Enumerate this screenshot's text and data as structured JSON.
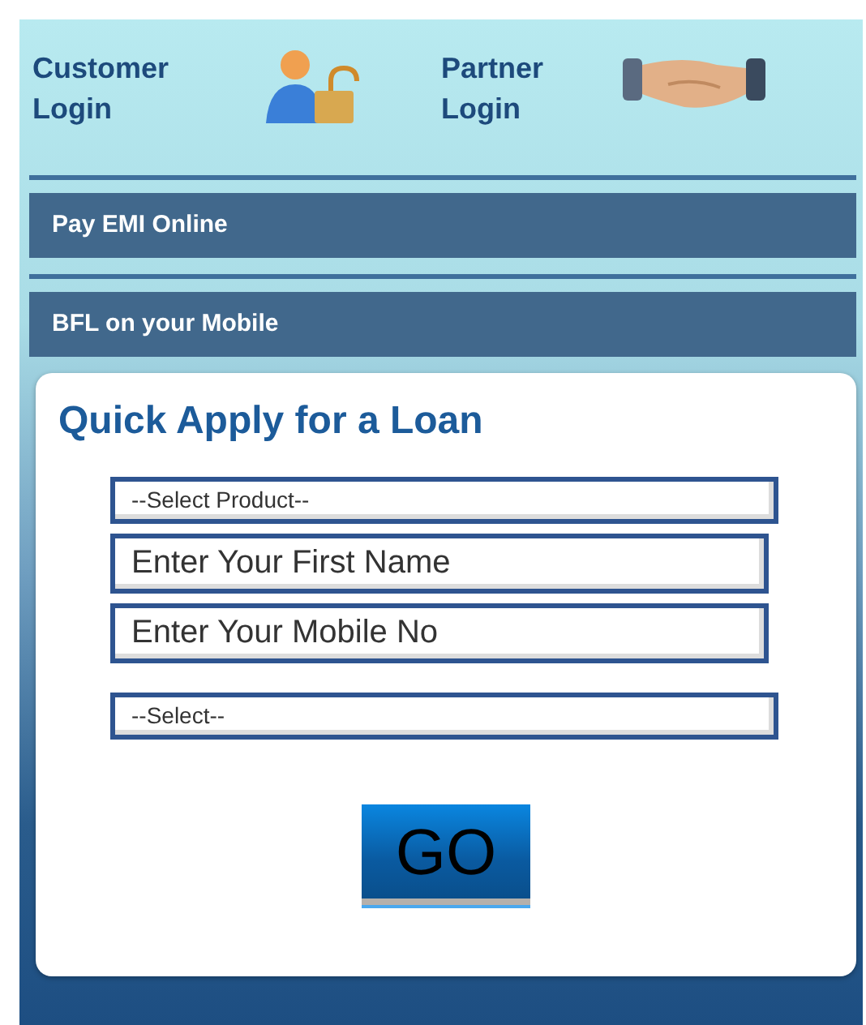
{
  "logins": [
    {
      "label": "Customer Login",
      "kind": "customer"
    },
    {
      "label": "Partner Login",
      "kind": "partner"
    }
  ],
  "menu": [
    "Pay EMI Online",
    "BFL on your Mobile"
  ],
  "quick_apply": {
    "title": "Quick Apply for a Loan",
    "fields": [
      {
        "kind": "select",
        "value": "--Select Product--"
      },
      {
        "kind": "text",
        "placeholder": "Enter Your First Name"
      },
      {
        "kind": "text",
        "placeholder": "Enter Your Mobile No"
      },
      {
        "kind": "select",
        "value": "--Select--"
      }
    ],
    "button": "GO"
  }
}
